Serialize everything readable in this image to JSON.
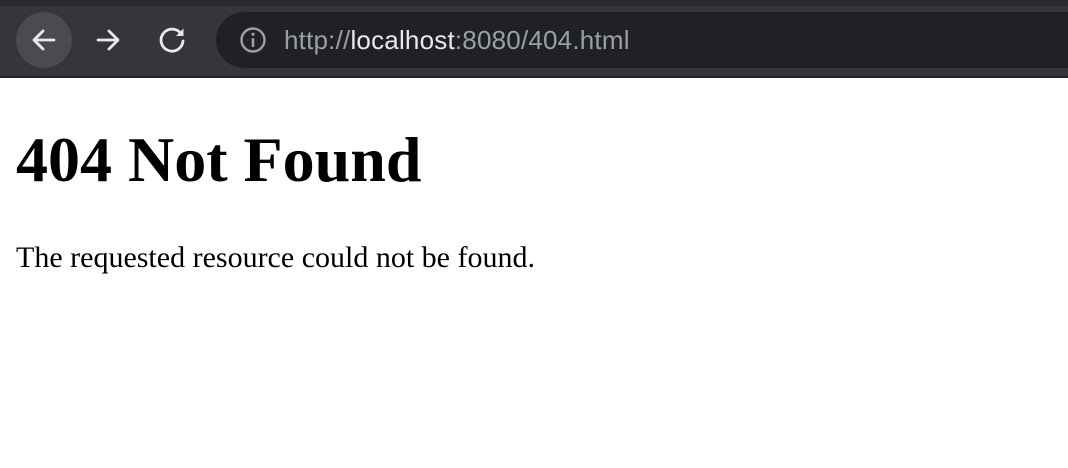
{
  "browser": {
    "url": {
      "scheme": "http://",
      "host": "localhost",
      "rest": ":8080/404.html"
    },
    "icons": {
      "back": "arrow-left-icon",
      "forward": "arrow-right-icon",
      "reload": "reload-icon",
      "site_info": "info-circle-icon"
    },
    "colors": {
      "toolbar_bg": "#35363a",
      "omnibox_bg": "#202124",
      "url_dim": "#9aa0a6",
      "url_host": "#e8eaed",
      "icon": "#e8eaed"
    }
  },
  "page": {
    "heading": "404 Not Found",
    "message": "The requested resource could not be found."
  }
}
